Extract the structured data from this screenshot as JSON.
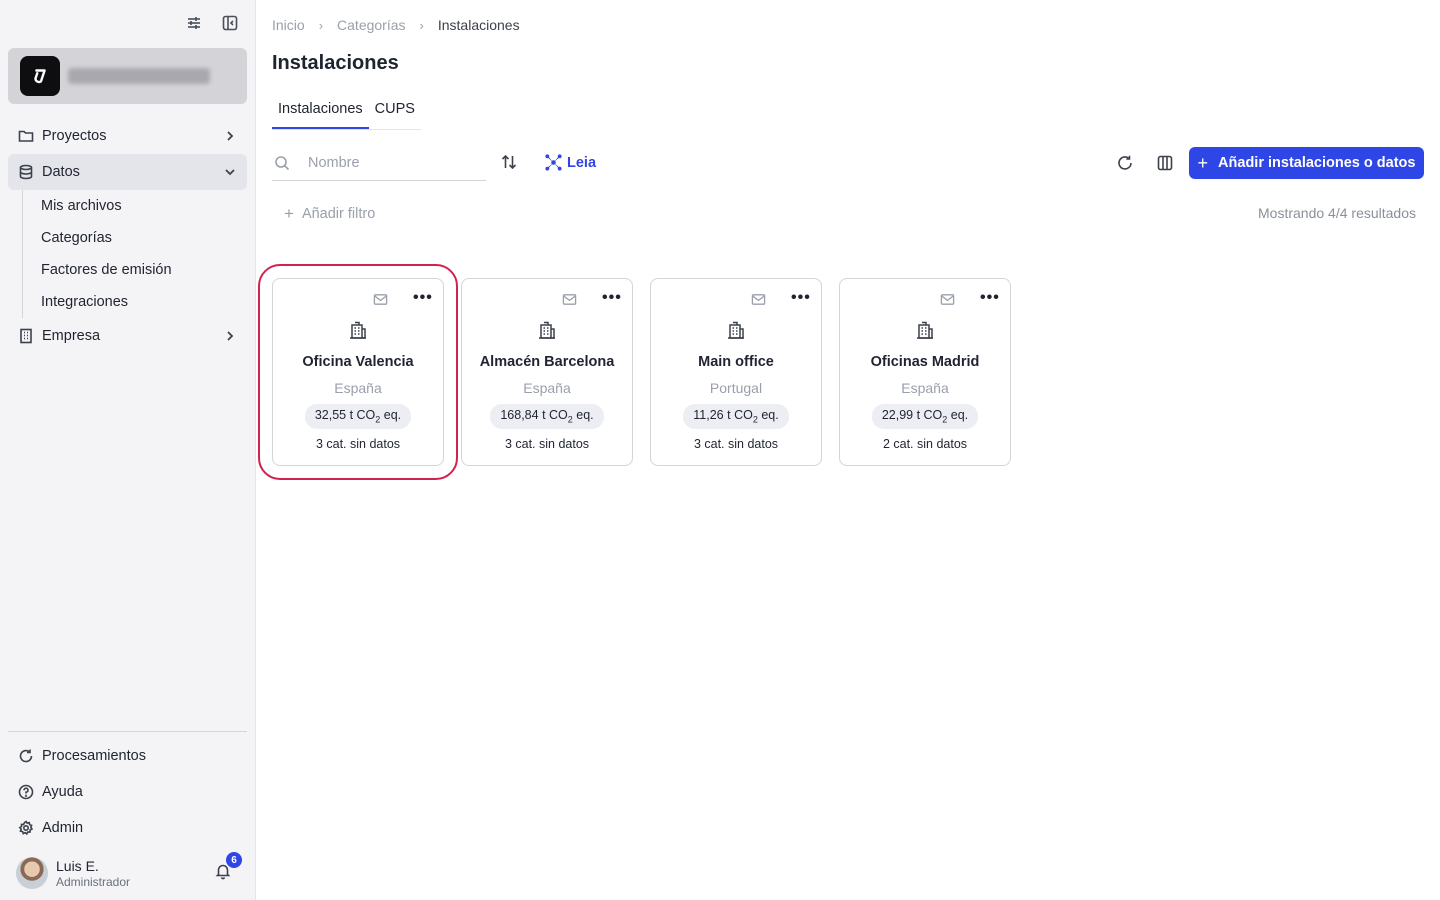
{
  "sidebar": {
    "nav": {
      "proyectos": "Proyectos",
      "datos": "Datos",
      "sub": [
        "Mis archivos",
        "Categorías",
        "Factores de emisión",
        "Integraciones"
      ],
      "empresa": "Empresa"
    },
    "bottom": {
      "procesamientos": "Procesamientos",
      "ayuda": "Ayuda",
      "admin": "Admin"
    },
    "user": {
      "name": "Luis E.",
      "role": "Administrador",
      "notifications": "6"
    }
  },
  "breadcrumb": [
    "Inicio",
    "Categorías",
    "Instalaciones"
  ],
  "page_title": "Instalaciones",
  "tabs": [
    {
      "label": "Instalaciones",
      "active": true
    },
    {
      "label": "CUPS",
      "active": false
    }
  ],
  "toolbar": {
    "search_placeholder": "Nombre",
    "leia_label": "Leia",
    "add_label": "Añadir instalaciones o datos",
    "add_filter_label": "Añadir filtro",
    "results_text": "Mostrando 4/4 resultados"
  },
  "cards": [
    {
      "name": "Oficina Valencia",
      "country": "España",
      "emissions": "32,55",
      "missing": "3 cat. sin datos",
      "selected": true
    },
    {
      "name": "Almacén Barcelona",
      "country": "España",
      "emissions": "168,84",
      "missing": "3 cat. sin datos",
      "selected": false
    },
    {
      "name": "Main office",
      "country": "Portugal",
      "emissions": "11,26",
      "missing": "3 cat. sin datos",
      "selected": false
    },
    {
      "name": "Oficinas Madrid",
      "country": "España",
      "emissions": "22,99",
      "missing": "2 cat. sin datos",
      "selected": false
    }
  ],
  "emissions_unit": {
    "prefix": "t CO",
    "subscript": "2",
    "suffix": "eq."
  },
  "colors": {
    "accent": "#2f46e6",
    "highlight": "#d0234e"
  }
}
